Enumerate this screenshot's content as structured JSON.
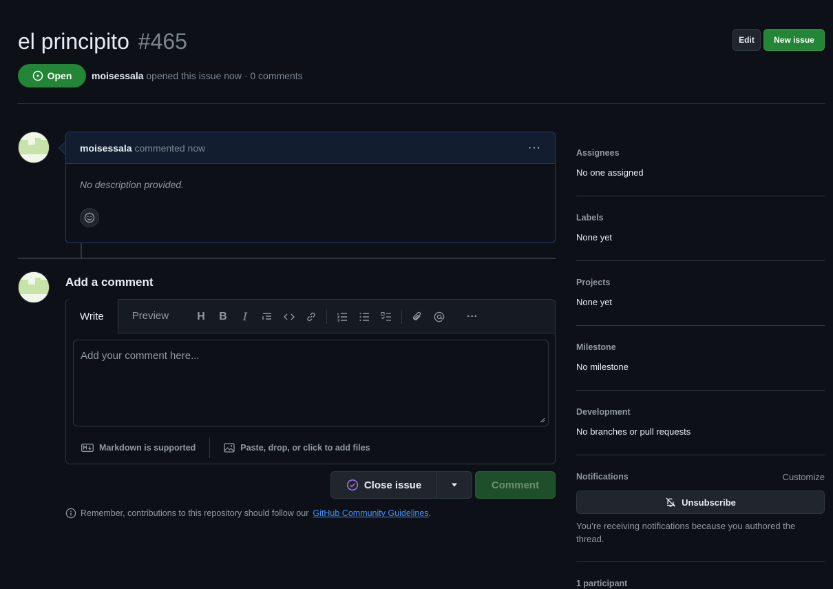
{
  "header": {
    "title": "el principito",
    "number": "#465",
    "edit_label": "Edit",
    "new_issue_label": "New issue",
    "state_label": "Open",
    "author": "moisessala",
    "meta_text": "opened this issue now · 0 comments"
  },
  "comment": {
    "author": "moisessala",
    "time_text": "commented now",
    "more_label": "···",
    "body": "No description provided."
  },
  "composer": {
    "title": "Add a comment",
    "tabs": [
      "Write",
      "Preview"
    ],
    "placeholder": "Add your comment here...",
    "markdown_label": "Markdown is supported",
    "attach_label": "Paste, drop, or click to add files",
    "close_label": "Close issue",
    "comment_label": "Comment",
    "guideline_prefix": "Remember, contributions to this repository should follow our",
    "guideline_link": "GitHub Community Guidelines",
    "guideline_suffix": "."
  },
  "sidebar": {
    "assignees_label": "Assignees",
    "assignees_value": "No one assigned",
    "labels_label": "Labels",
    "labels_value": "None yet",
    "projects_label": "Projects",
    "projects_value": "None yet",
    "milestone_label": "Milestone",
    "milestone_value": "No milestone",
    "development_label": "Development",
    "development_value": "No branches or pull requests",
    "notifications_label": "Notifications",
    "customize_label": "Customize",
    "unsubscribe_label": "Unsubscribe",
    "notifications_note": "You’re receiving notifications because you authored the thread.",
    "participants_label": "1 participant"
  },
  "colors": {
    "background": "#0d1117",
    "open_green": "#238636",
    "link_blue": "#4493f8",
    "close_purple": "#a371f7"
  }
}
